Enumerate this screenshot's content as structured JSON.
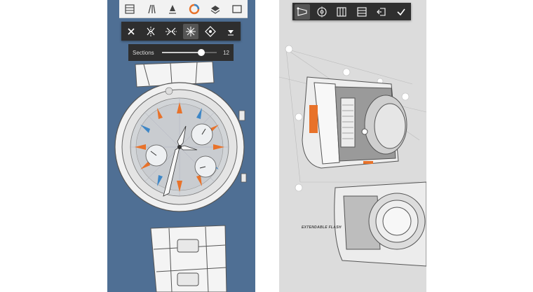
{
  "left_app": {
    "top_toolbar": {
      "icons": [
        "layout-icon",
        "brush-tools-icon",
        "pen-nib-icon",
        "color-wheel-icon",
        "layers-icon",
        "canvas-icon"
      ]
    },
    "symmetry_toolbar": {
      "icons": [
        "close-icon",
        "mirror-symmetry-icon",
        "two-axis-symmetry-icon",
        "radial-symmetry-icon",
        "kaleidoscope-icon",
        "more-options-icon"
      ]
    },
    "sections_slider": {
      "label": "Sections",
      "value": "12",
      "fraction": 0.72
    }
  },
  "right_app": {
    "toolbar": {
      "icons": [
        "perspective-guide-icon",
        "ellipse-guide-icon",
        "vertical-split-icon",
        "horizontal-split-icon",
        "exit-guide-icon",
        "confirm-icon"
      ]
    },
    "annotations": {
      "flash": "EXTENDABLE FLASH"
    }
  },
  "colors": {
    "accent_orange": "#e8722a",
    "accent_blue": "#3d86c6",
    "left_background": "#4f6f94",
    "right_background": "#dcdcdc",
    "toolbar_dark": "#2e2e2e"
  }
}
